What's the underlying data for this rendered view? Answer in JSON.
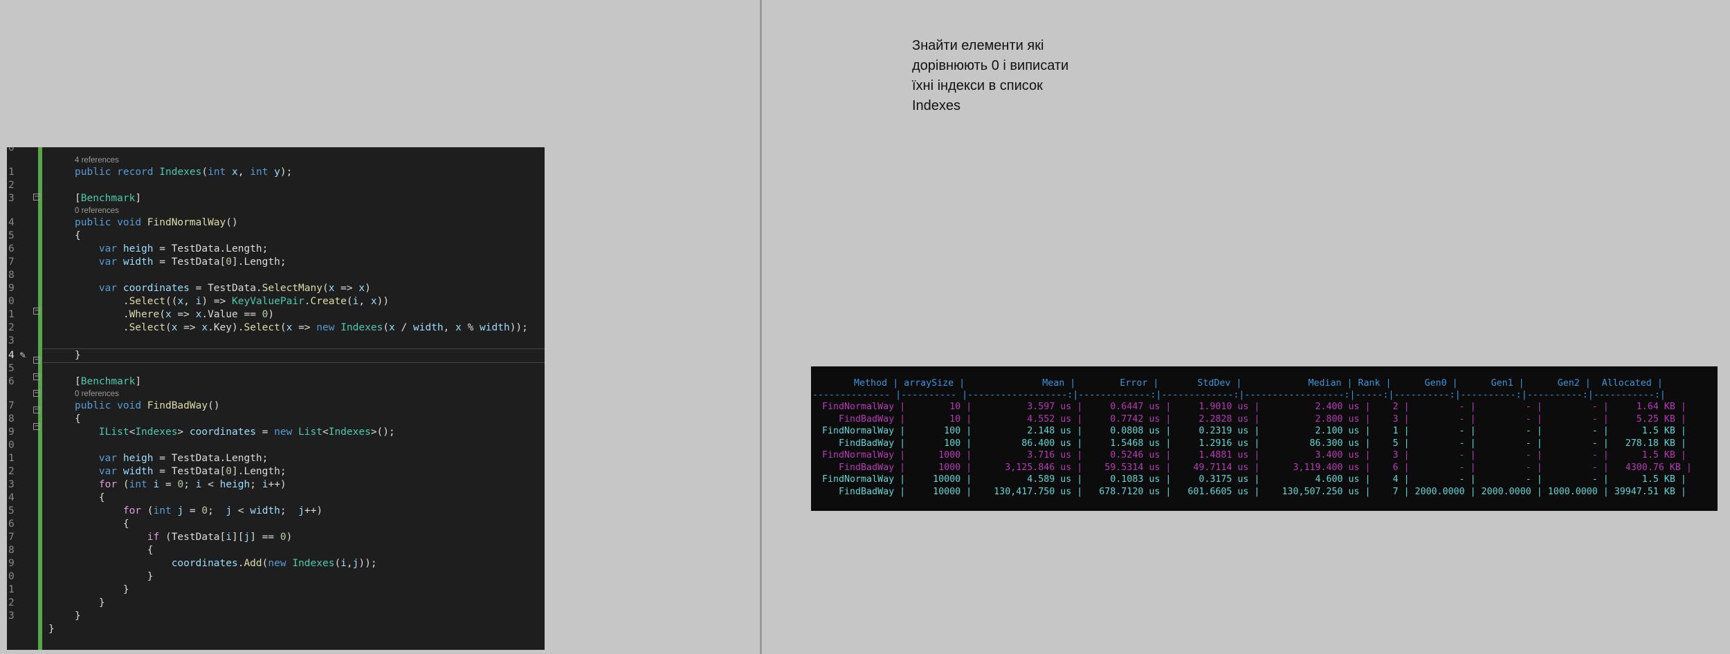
{
  "code": {
    "codelens_4_references": "4 references",
    "codelens_0_references_a": "0 references",
    "codelens_0_references_b": "0 references",
    "line_numbers": [
      "0",
      "1",
      "2",
      "3",
      "4",
      "5",
      "6",
      "7",
      "8",
      "9",
      "0",
      "1",
      "2",
      "3",
      "4",
      "5",
      "6",
      "7",
      "8",
      "9",
      "0",
      "1",
      "2",
      "3",
      "4",
      "5",
      "6",
      "7",
      "8",
      "9",
      "0",
      "1",
      "2",
      "3"
    ]
  },
  "note": {
    "lines": [
      "Знайти елементи які",
      "дорівнюють 0 і виписати",
      "їхні індекси в список",
      "Indexes"
    ]
  },
  "benchmark": {
    "header": "       Method | arraySize |              Mean |        Error |       StdDev |            Median | Rank |      Gen0 |      Gen1 |      Gen2 |  Allocated |",
    "separator": "-------------- |---------- |------------------:|-------------:|-------------:|------------------:|-----:|----------:|----------:|----------:|-----------:|",
    "rows": [
      {
        "color": "mag",
        "text": "  FindNormalWay |        10 |          3.597 us |     0.6447 us |     1.9010 us |          2.400 us |    2 |         - |         - |         - |     1.64 KB |"
      },
      {
        "color": "mag",
        "text": "     FindBadWay |        10 |          4.552 us |     0.7742 us |     2.2828 us |          2.800 us |    3 |         - |         - |         - |     5.25 KB |"
      },
      {
        "color": "cyan",
        "text": "  FindNormalWay |       100 |          2.148 us |     0.0808 us |     0.2319 us |          2.100 us |    1 |         - |         - |         - |      1.5 KB |"
      },
      {
        "color": "cyan",
        "text": "     FindBadWay |       100 |         86.400 us |     1.5468 us |     1.2916 us |         86.300 us |    5 |         - |         - |         - |   278.18 KB |"
      },
      {
        "color": "mag",
        "text": "  FindNormalWay |      1000 |          3.716 us |     0.5246 us |     1.4881 us |          3.400 us |    3 |         - |         - |         - |      1.5 KB |"
      },
      {
        "color": "mag",
        "text": "     FindBadWay |      1000 |      3,125.846 us |    59.5314 us |    49.7114 us |      3,119.400 us |    6 |         - |         - |         - |   4300.76 KB |"
      },
      {
        "color": "cyan",
        "text": "  FindNormalWay |     10000 |          4.589 us |     0.1083 us |     0.3175 us |          4.600 us |    4 |         - |         - |         - |      1.5 KB |"
      },
      {
        "color": "cyan",
        "text": "     FindBadWay |     10000 |    130,417.750 us |   678.7120 us |   601.6605 us |    130,507.250 us |    7 | 2000.0000 | 2000.0000 | 1000.0000 | 39947.51 KB |"
      }
    ]
  },
  "colors": {
    "background": "#c6c6c6",
    "editor_bg": "#1e1e1e",
    "terminal_bg": "#0c0c0c",
    "keyword": "#569cd6",
    "type": "#4ec9b0",
    "method": "#dcdcaa",
    "variable": "#9cdcfe",
    "magenta": "#b83ab8",
    "cyan": "#61d6d6"
  }
}
